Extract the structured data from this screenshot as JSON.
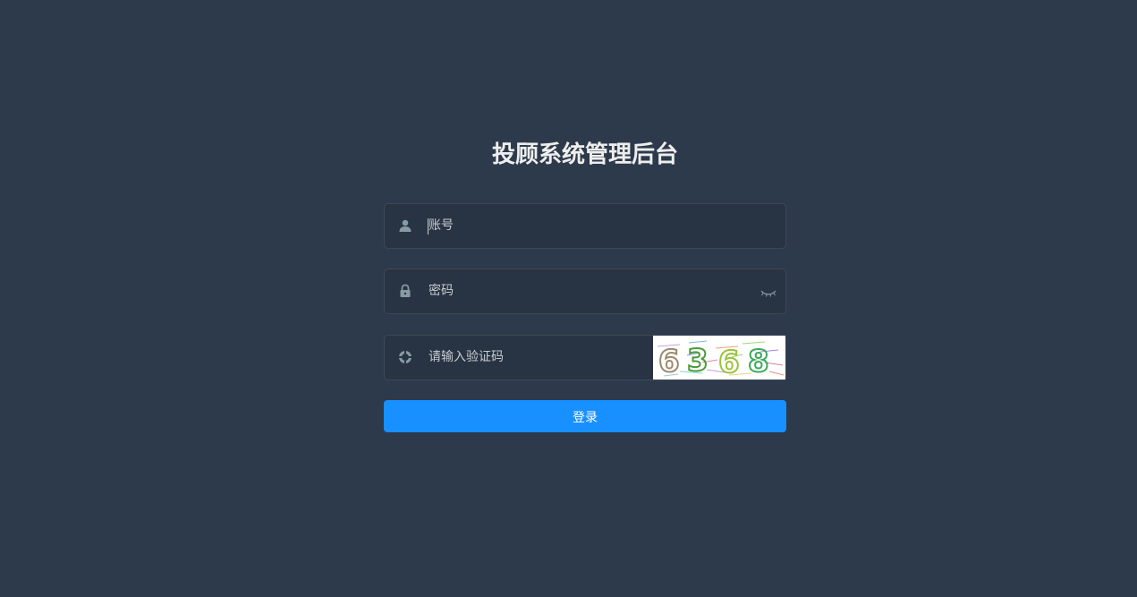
{
  "title": "投顾系统管理后台",
  "form": {
    "username_placeholder": "账号",
    "password_placeholder": "密码",
    "captcha_placeholder": "请输入验证码",
    "captcha_code": "6368",
    "login_label": "登录"
  },
  "icons": {
    "user": "user-icon",
    "lock": "lock-icon",
    "captcha": "captcha-icon",
    "eye": "eye-closed-icon"
  },
  "colors": {
    "background": "#2d3a4b",
    "input_bg": "#283443",
    "primary": "#1890ff",
    "title": "#eeeeee"
  }
}
